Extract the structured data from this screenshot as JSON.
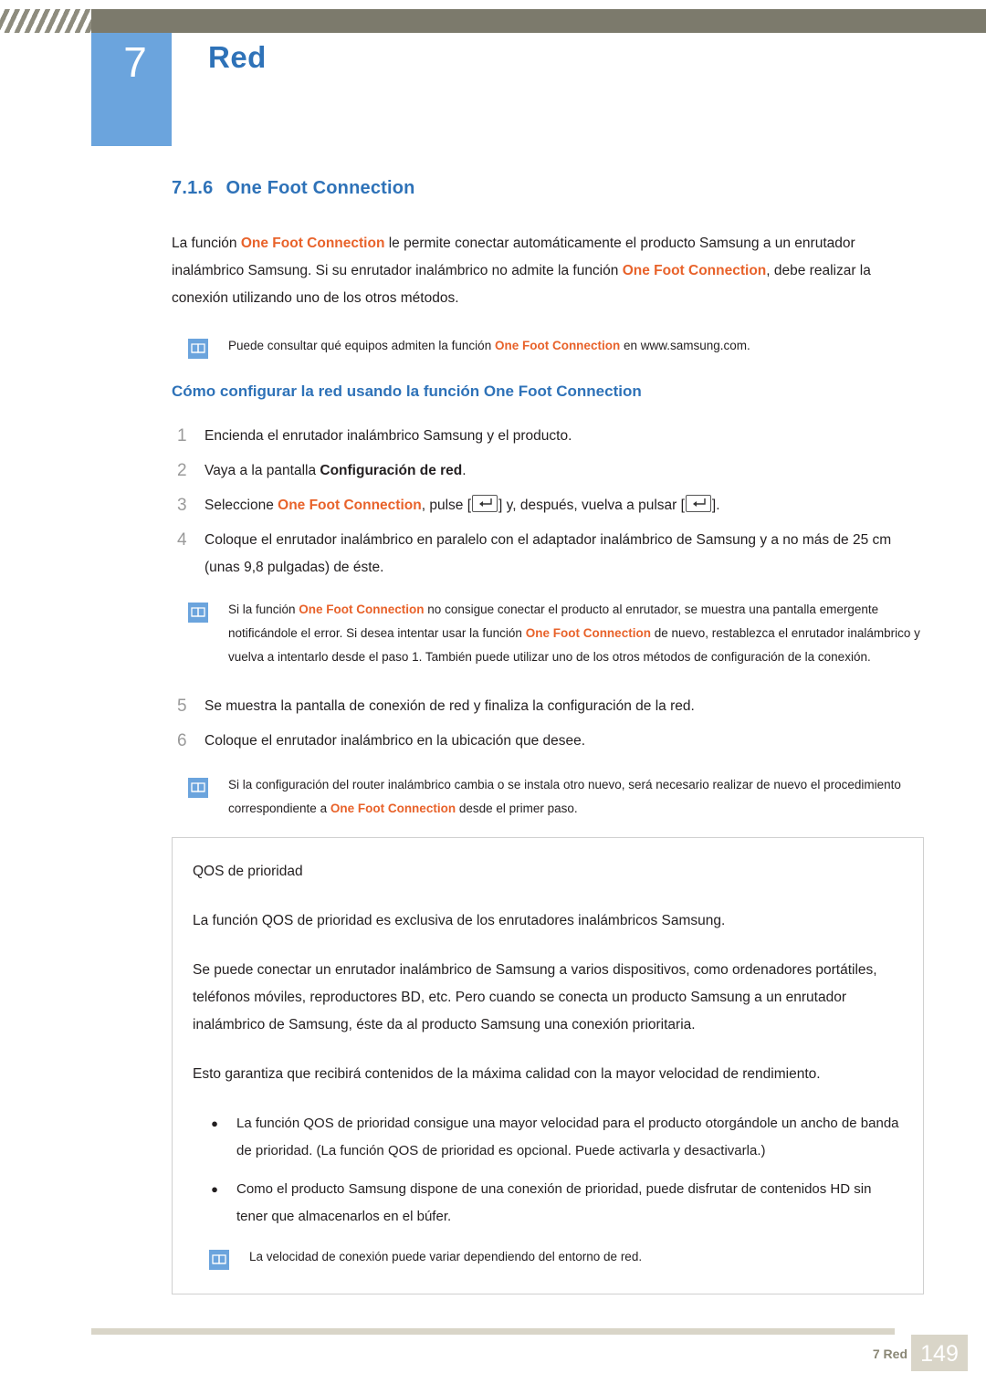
{
  "header": {
    "chapter_number": "7",
    "chapter_title": "Red"
  },
  "section": {
    "number": "7.1.6",
    "title": "One Foot Connection"
  },
  "intro": {
    "part1": "La función ",
    "hl1": "One Foot Connection",
    "part2": " le permite conectar automáticamente el producto Samsung a un enrutador inalámbrico Samsung. Si su enrutador inalámbrico no admite la función ",
    "hl2": "One Foot Connection",
    "part3": ", debe realizar la conexión utilizando uno de los otros métodos."
  },
  "note1": {
    "part1": "Puede consultar qué equipos admiten la función ",
    "hl1": "One Foot Connection",
    "part2": " en www.samsung.com."
  },
  "subhead": "Cómo configurar la red usando la función One Foot Connection",
  "steps": [
    {
      "num": "1",
      "text": "Encienda el enrutador inalámbrico Samsung y el producto."
    },
    {
      "num": "2",
      "pre": "Vaya a la pantalla ",
      "bold": "Configuración de red",
      "post": "."
    },
    {
      "num": "3",
      "pre": "Seleccione ",
      "hl": "One Foot Connection",
      "mid": ", pulse [",
      "mid2": "] y, después, vuelva a pulsar [",
      "post": "]."
    },
    {
      "num": "4",
      "text": "Coloque el enrutador inalámbrico en paralelo con el adaptador inalámbrico de Samsung y a no más de 25 cm (unas 9,8 pulgadas) de éste."
    },
    {
      "num": "5",
      "text": "Se muestra la pantalla de conexión de red y finaliza la configuración de la red."
    },
    {
      "num": "6",
      "text": "Coloque el enrutador inalámbrico en la ubicación que desee."
    }
  ],
  "note2": {
    "part1": "Si la función ",
    "hl1": "One Foot Connection",
    "part2": " no consigue conectar el producto al enrutador, se muestra una pantalla emergente notificándole el error. Si desea intentar usar la función ",
    "hl2": "One Foot Connection",
    "part3": " de nuevo, restablezca el enrutador inalámbrico y vuelva a intentarlo desde el paso 1. También puede utilizar uno de los otros métodos de configuración de la conexión."
  },
  "note3": {
    "part1": "Si la configuración del router inalámbrico cambia o se instala otro nuevo, será necesario realizar de nuevo el procedimiento correspondiente a ",
    "hl1": "One Foot Connection",
    "part2": " desde el primer paso."
  },
  "qos": {
    "title": "QOS de prioridad",
    "p1": "La función QOS de prioridad es exclusiva de los enrutadores inalámbricos Samsung.",
    "p2": "Se puede conectar un enrutador inalámbrico de Samsung a varios dispositivos, como ordenadores portátiles, teléfonos móviles, reproductores BD, etc. Pero cuando se conecta un producto Samsung a un enrutador inalámbrico de Samsung, éste da al producto Samsung una conexión prioritaria.",
    "p3": "Esto garantiza que recibirá contenidos de la máxima calidad con la mayor velocidad de rendimiento.",
    "bullets": [
      "La función QOS de prioridad consigue una mayor velocidad para el producto otorgándole un ancho de banda de prioridad. (La función QOS de prioridad es opcional. Puede activarla y desactivarla.)",
      "Como el producto Samsung dispone de una conexión de prioridad, puede disfrutar de contenidos HD sin tener que almacenarlos en el búfer."
    ],
    "note": "La velocidad de conexión puede variar dependiendo del entorno de red."
  },
  "footer": {
    "label": "7 Red",
    "page": "149"
  },
  "colors": {
    "accent_blue": "#2e72b8",
    "highlight_orange": "#e8622a",
    "chapter_block": "#6ba4dd",
    "header_bar": "#7c7a6c",
    "footer_bar": "#d9d5c8"
  }
}
